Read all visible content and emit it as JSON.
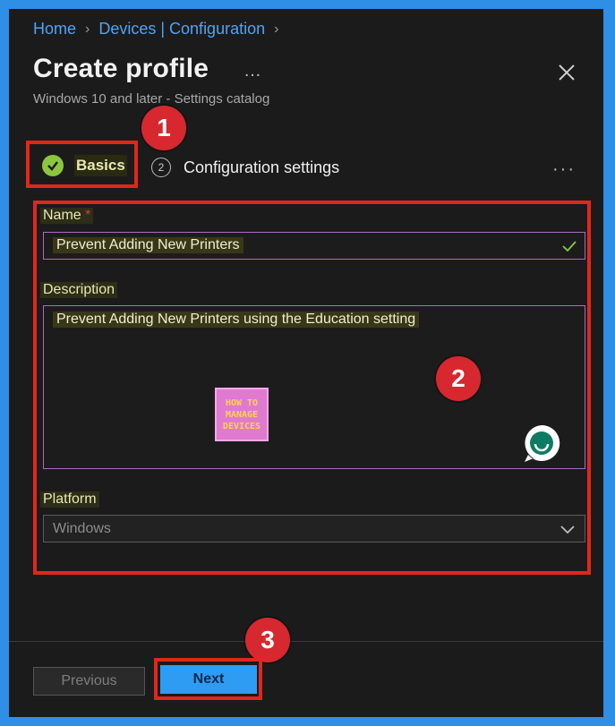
{
  "breadcrumb": {
    "items": [
      "Home",
      "Devices | Configuration"
    ]
  },
  "header": {
    "title": "Create profile",
    "more": "…",
    "subtitle": "Windows 10 and later - Settings catalog"
  },
  "steps": {
    "basics": {
      "label": "Basics",
      "state": "complete"
    },
    "config": {
      "number": "2",
      "label": "Configuration settings"
    },
    "more": "···"
  },
  "annotations": {
    "badge1": "1",
    "badge2": "2",
    "badge3": "3"
  },
  "form": {
    "name_label": "Name",
    "required_mark": "*",
    "name_value": "Prevent Adding New Printers",
    "description_label": "Description",
    "description_value": "Prevent Adding New Printers using the Education setting",
    "platform_label": "Platform",
    "platform_value": "Windows"
  },
  "logo": {
    "line1": "HOW TO",
    "line2": "MANAGE",
    "line3": "DEVICES"
  },
  "footer": {
    "previous_label": "Previous",
    "next_label": "Next"
  },
  "colors": {
    "accent": "#2d9cf2",
    "highlight_box": "#e1261c",
    "badge": "#d7282f",
    "complete_check": "#8cc63f",
    "link": "#4fa3f7"
  }
}
